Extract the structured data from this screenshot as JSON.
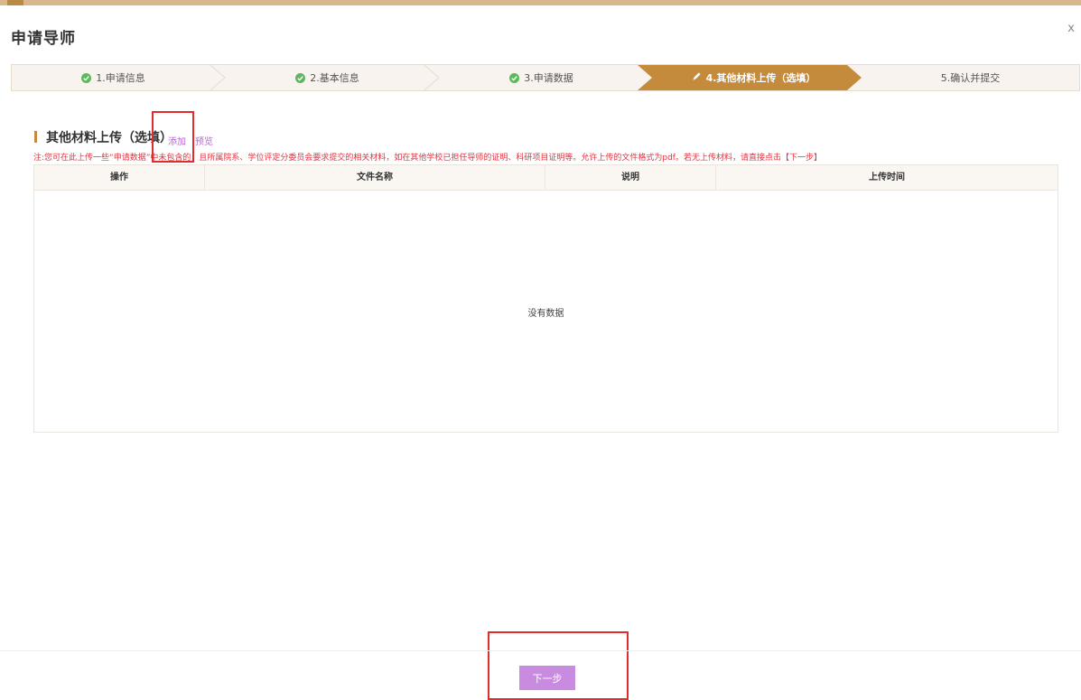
{
  "header": {
    "title": "申请导师",
    "close": "x"
  },
  "steps": [
    {
      "label": "1.申请信息",
      "state": "done",
      "icon": "check-circle-icon"
    },
    {
      "label": "2.基本信息",
      "state": "done",
      "icon": "check-circle-icon"
    },
    {
      "label": "3.申请数据",
      "state": "done",
      "icon": "check-circle-icon"
    },
    {
      "label": "4.其他材料上传（选填）",
      "state": "active",
      "icon": "pencil-icon"
    },
    {
      "label": "5.确认并提交",
      "state": "pending"
    }
  ],
  "section": {
    "title": "其他材料上传（选填）",
    "add_link": "添加",
    "preview_link": "预览",
    "note": "注:您可在此上传一些“申请数据”中未包含的，且所属院系、学位评定分委员会要求提交的相关材料，如在其他学校已担任导师的证明、科研项目证明等。允许上传的文件格式为pdf。若无上传材料，请直接点击【下一步】"
  },
  "table": {
    "columns": [
      "操作",
      "文件名称",
      "说明",
      "上传时间"
    ],
    "empty_text": "没有数据"
  },
  "footer": {
    "next_label": "下一步"
  },
  "colors": {
    "accent": "#c58b3d",
    "active_step": "#c58b3d",
    "link": "#b565d6",
    "note": "#e0343f",
    "button": "#c88be0",
    "check": "#5cb85c",
    "highlight": "#e22d2d"
  }
}
